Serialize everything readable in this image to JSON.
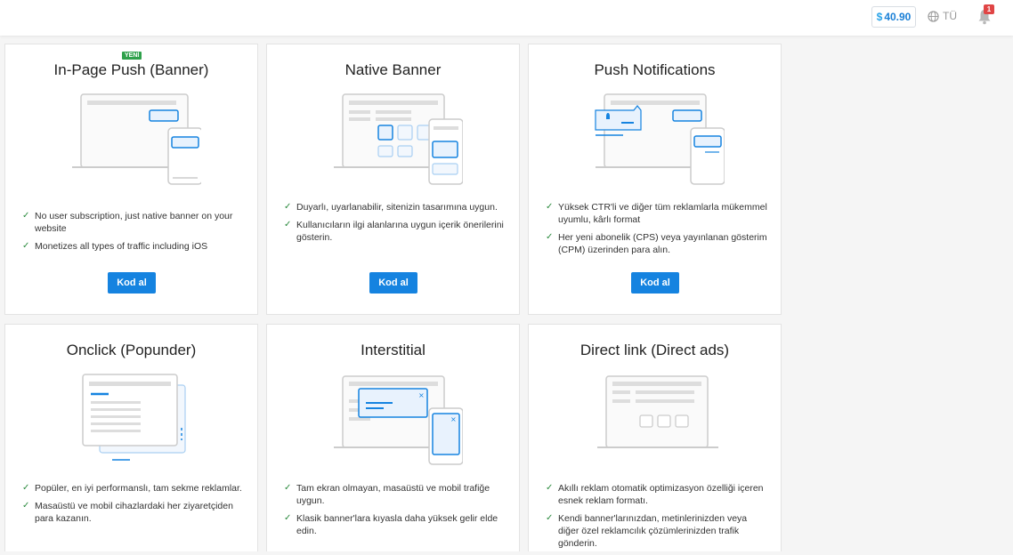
{
  "header": {
    "balance_currency": "$",
    "balance_value": "40.90",
    "language": "TÜ",
    "notifications_count": "1"
  },
  "cards": [
    {
      "title": "In-Page Push (Banner)",
      "badge": "YENİ",
      "features": [
        "No user subscription, just native banner on your website",
        "Monetizes all types of traffic including iOS"
      ],
      "button": "Kod al"
    },
    {
      "title": "Native Banner",
      "features": [
        "Duyarlı, uyarlanabilir, sitenizin tasarımına uygun.",
        "Kullanıcıların ilgi alanlarına uygun içerik önerilerini gösterin."
      ],
      "button": "Kod al"
    },
    {
      "title": "Push Notifications",
      "features": [
        "Yüksek CTR'li ve diğer tüm reklamlarla mükemmel uyumlu, kârlı format",
        "Her yeni abonelik (CPS) veya yayınlanan gösterim (CPM) üzerinden para alın."
      ],
      "button": "Kod al"
    },
    {
      "title": "Onclick (Popunder)",
      "features": [
        "Popüler, en iyi performanslı, tam sekme reklamlar.",
        "Masaüstü ve mobil cihazlardaki her ziyaretçiden para kazanın."
      ]
    },
    {
      "title": "Interstitial",
      "features": [
        "Tam ekran olmayan, masaüstü ve mobil trafiğe uygun.",
        "Klasik banner'lara kıyasla daha yüksek gelir elde edin."
      ]
    },
    {
      "title": "Direct link (Direct ads)",
      "features": [
        "Akıllı reklam otomatik optimizasyon özelliği içeren esnek reklam formatı.",
        "Kendi banner'larınızdan, metinlerinizden veya diğer özel reklamcılık çözümlerinizden trafik gönderin."
      ]
    }
  ],
  "colors": {
    "accent": "#1583e0",
    "check": "#2b8a3e",
    "badge_new": "#2fa14b",
    "notification": "#e04545"
  }
}
